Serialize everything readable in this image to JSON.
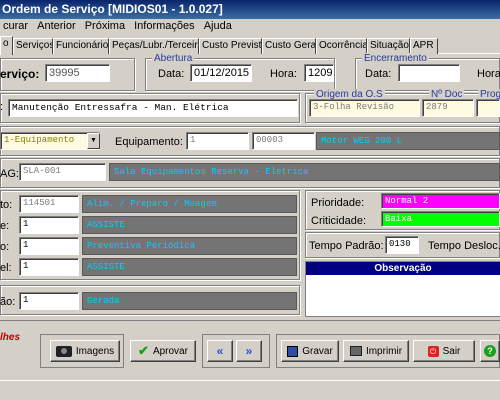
{
  "window": {
    "title": "Ordem de Serviço   [MIDIOS01 - 1.0.027]"
  },
  "menu": [
    "curar",
    "Anterior",
    "Próxima",
    "Informações",
    "Ajuda"
  ],
  "tabs": [
    "o",
    "Serviços",
    "Funcionários",
    "Peças/Lubr./Terceiro",
    "Custo Previsto",
    "Custo Geral",
    "Ocorrência",
    "Situação",
    "APR"
  ],
  "header": {
    "service_label": "erviço:",
    "service_value": "39995",
    "abertura": {
      "title": "Abertura",
      "data_label": "Data:",
      "data_value": "01/12/2015",
      "hora_label": "Hora:",
      "hora_value": "1209"
    },
    "encerramento": {
      "title": "Encerramento",
      "data_label": "Data:",
      "data_value": "",
      "hora_label": "Hora"
    }
  },
  "description": {
    "value": "Manutenção Entressafra - Man. Elétrica"
  },
  "origem": {
    "origem_label": "Origem da O.S",
    "origem_value": "3-Folha Revisão",
    "ndoc_label": "Nº Doc",
    "ndoc_value": "2879",
    "prog_label": "Prog"
  },
  "equip": {
    "tipo_value": "1-Equipamento",
    "label": "Equipamento:",
    "code": "1",
    "number": "00003",
    "name": "Motor WEG 200 L"
  },
  "tag": {
    "label": "AG:",
    "value": "SLA-001",
    "desc": "Sala Equipamentos Reserva - Eletrica"
  },
  "rows": [
    {
      "label": "to:",
      "value": "114501",
      "desc": "Alim. / Preparo / Moagem"
    },
    {
      "label": "e:",
      "value": "1",
      "desc": "ASSISTE"
    },
    {
      "label": "o:",
      "value": "1",
      "desc": "Preventiva Periódica"
    },
    {
      "label": "el:",
      "value": "1",
      "desc": "ASSISTE"
    }
  ],
  "situacao": {
    "label": "ão:",
    "value": "1",
    "desc": "Gerada"
  },
  "prioridade": {
    "label": "Prioridade:",
    "value": "Normal 2",
    "color": "#ff00ff"
  },
  "criticidade": {
    "label": "Criticidade:",
    "value": "Baixa",
    "color": "#00ff00"
  },
  "tempo": {
    "padrao_label": "Tempo Padrão:",
    "padrao_value": "0130",
    "desloc_label": "Tempo Desloc."
  },
  "observacao": {
    "title": "Observação"
  },
  "footer": {
    "left_text": "lhes"
  },
  "buttons": {
    "imagens": "Imagens",
    "aprovar": "Aprovar",
    "gravar": "Gravar",
    "imprimir": "Imprimir",
    "sair": "Sair"
  }
}
